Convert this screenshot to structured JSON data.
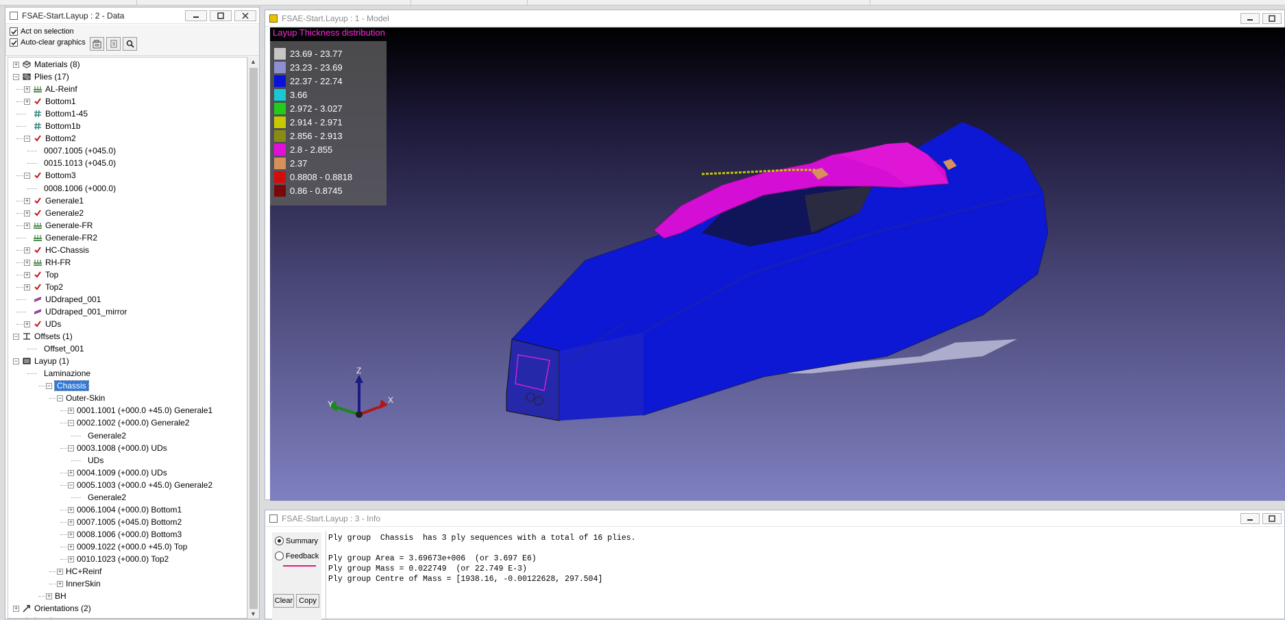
{
  "data_window": {
    "title": "FSAE-Start.Layup : 2 - Data",
    "act_on_selection": "Act on selection",
    "auto_clear": "Auto-clear graphics",
    "tree": [
      {
        "label": "Materials (8)",
        "level": 0,
        "exp": "+",
        "icon": "materials-icon"
      },
      {
        "label": "Plies (17)",
        "level": 0,
        "exp": "-",
        "icon": "plies-icon"
      },
      {
        "label": "AL-Reinf",
        "level": 1,
        "exp": "+",
        "icon": "ply-stack-icon"
      },
      {
        "label": "Bottom1",
        "level": 1,
        "exp": "+",
        "icon": "check-icon"
      },
      {
        "label": "Bottom1-45",
        "level": 1,
        "exp": "",
        "icon": "hash-icon"
      },
      {
        "label": "Bottom1b",
        "level": 1,
        "exp": "",
        "icon": "hash-icon"
      },
      {
        "label": "Bottom2",
        "level": 1,
        "exp": "-",
        "icon": "check-icon"
      },
      {
        "label": "0007.1005 (+045.0)",
        "level": 2,
        "exp": "",
        "icon": ""
      },
      {
        "label": "0015.1013 (+045.0)",
        "level": 2,
        "exp": "",
        "icon": ""
      },
      {
        "label": "Bottom3",
        "level": 1,
        "exp": "-",
        "icon": "check-icon"
      },
      {
        "label": "0008.1006 (+000.0)",
        "level": 2,
        "exp": "",
        "icon": ""
      },
      {
        "label": "Generale1",
        "level": 1,
        "exp": "+",
        "icon": "check-icon"
      },
      {
        "label": "Generale2",
        "level": 1,
        "exp": "+",
        "icon": "check-icon"
      },
      {
        "label": "Generale-FR",
        "level": 1,
        "exp": "+",
        "icon": "ply-stack-icon"
      },
      {
        "label": "Generale-FR2",
        "level": 1,
        "exp": "",
        "icon": "ply-stack-icon"
      },
      {
        "label": "HC-Chassis",
        "level": 1,
        "exp": "+",
        "icon": "check-icon"
      },
      {
        "label": "RH-FR",
        "level": 1,
        "exp": "+",
        "icon": "ply-stack-icon"
      },
      {
        "label": "Top",
        "level": 1,
        "exp": "+",
        "icon": "check-icon"
      },
      {
        "label": "Top2",
        "level": 1,
        "exp": "+",
        "icon": "check-icon"
      },
      {
        "label": "UDdraped_001",
        "level": 1,
        "exp": "",
        "icon": "draped-icon"
      },
      {
        "label": "UDdraped_001_mirror",
        "level": 1,
        "exp": "",
        "icon": "draped-icon"
      },
      {
        "label": "UDs",
        "level": 1,
        "exp": "+",
        "icon": "check-icon"
      },
      {
        "label": "Offsets (1)",
        "level": 0,
        "exp": "-",
        "icon": "offsets-icon"
      },
      {
        "label": "Offset_001",
        "level": 2,
        "exp": "",
        "icon": ""
      },
      {
        "label": "Layup (1)",
        "level": 0,
        "exp": "-",
        "icon": "layup-icon"
      },
      {
        "label": "Laminazione",
        "level": 2,
        "exp": "",
        "icon": ""
      },
      {
        "label": "Chassis",
        "level": 3,
        "exp": "-",
        "icon": "",
        "selected": true
      },
      {
        "label": "Outer-Skin",
        "level": 4,
        "exp": "-",
        "icon": ""
      },
      {
        "label": "0001.1001 (+000.0 +45.0)  Generale1",
        "level": 5,
        "exp": "+",
        "icon": ""
      },
      {
        "label": "0002.1002 (+000.0)  Generale2",
        "level": 5,
        "exp": "-",
        "icon": ""
      },
      {
        "label": "Generale2",
        "level": 6,
        "exp": "",
        "icon": ""
      },
      {
        "label": "0003.1008 (+000.0)  UDs",
        "level": 5,
        "exp": "-",
        "icon": ""
      },
      {
        "label": "UDs",
        "level": 6,
        "exp": "",
        "icon": ""
      },
      {
        "label": "0004.1009 (+000.0)  UDs",
        "level": 5,
        "exp": "+",
        "icon": ""
      },
      {
        "label": "0005.1003 (+000.0 +45.0)  Generale2",
        "level": 5,
        "exp": "-",
        "icon": ""
      },
      {
        "label": "Generale2",
        "level": 6,
        "exp": "",
        "icon": ""
      },
      {
        "label": "0006.1004 (+000.0)  Bottom1",
        "level": 5,
        "exp": "+",
        "icon": ""
      },
      {
        "label": "0007.1005 (+045.0)  Bottom2",
        "level": 5,
        "exp": "+",
        "icon": ""
      },
      {
        "label": "0008.1006 (+000.0)  Bottom3",
        "level": 5,
        "exp": "+",
        "icon": ""
      },
      {
        "label": "0009.1022 (+000.0 +45.0)  Top",
        "level": 5,
        "exp": "+",
        "icon": ""
      },
      {
        "label": "0010.1023 (+000.0)  Top2",
        "level": 5,
        "exp": "+",
        "icon": ""
      },
      {
        "label": "HC+Reinf",
        "level": 4,
        "exp": "+",
        "icon": ""
      },
      {
        "label": "InnerSkin",
        "level": 4,
        "exp": "+",
        "icon": ""
      },
      {
        "label": "BH",
        "level": 3,
        "exp": "+",
        "icon": ""
      },
      {
        "label": "Orientations (2)",
        "level": 0,
        "exp": "+",
        "icon": "orientation-icon"
      },
      {
        "label": "Laminates",
        "level": 0,
        "exp": "",
        "icon": "laminates-icon"
      }
    ]
  },
  "model_window": {
    "title": "FSAE-Start.Layup : 1 - Model",
    "legend_title": "Layup Thickness distribution",
    "legend": [
      {
        "label": "23.69 - 23.77",
        "color": "#c6c6c6"
      },
      {
        "label": "23.23 - 23.69",
        "color": "#8d8fd0"
      },
      {
        "label": "22.37 - 22.74",
        "color": "#0a12d8"
      },
      {
        "label": "3.66",
        "color": "#18c9d2"
      },
      {
        "label": "2.972 - 3.027",
        "color": "#22cc18"
      },
      {
        "label": "2.914 - 2.971",
        "color": "#c8c800"
      },
      {
        "label": "2.856 - 2.913",
        "color": "#8a8a16"
      },
      {
        "label": "2.8 - 2.855",
        "color": "#e010d8"
      },
      {
        "label": "2.37",
        "color": "#d8905a"
      },
      {
        "label": "0.8808 - 0.8818",
        "color": "#d40c0c"
      },
      {
        "label": "0.86 - 0.8745",
        "color": "#7a0808"
      }
    ],
    "axis": {
      "x": "X",
      "y": "Y",
      "z": "Z"
    }
  },
  "info_window": {
    "title": "FSAE-Start.Layup : 3 - Info",
    "radio_summary": "Summary",
    "radio_feedback": "Feedback",
    "clear_label": "Clear",
    "copy_label": "Copy",
    "lines": [
      "Ply group  Chassis  has 3 ply sequences with a total of 16 plies.",
      "",
      "Ply group Area = 3.69673e+006  (or 3.697 E6)",
      "Ply group Mass = 0.022749  (or 22.749 E-3)",
      "Ply group Centre of Mass = [1938.16, -0.00122628, 297.504]"
    ]
  }
}
